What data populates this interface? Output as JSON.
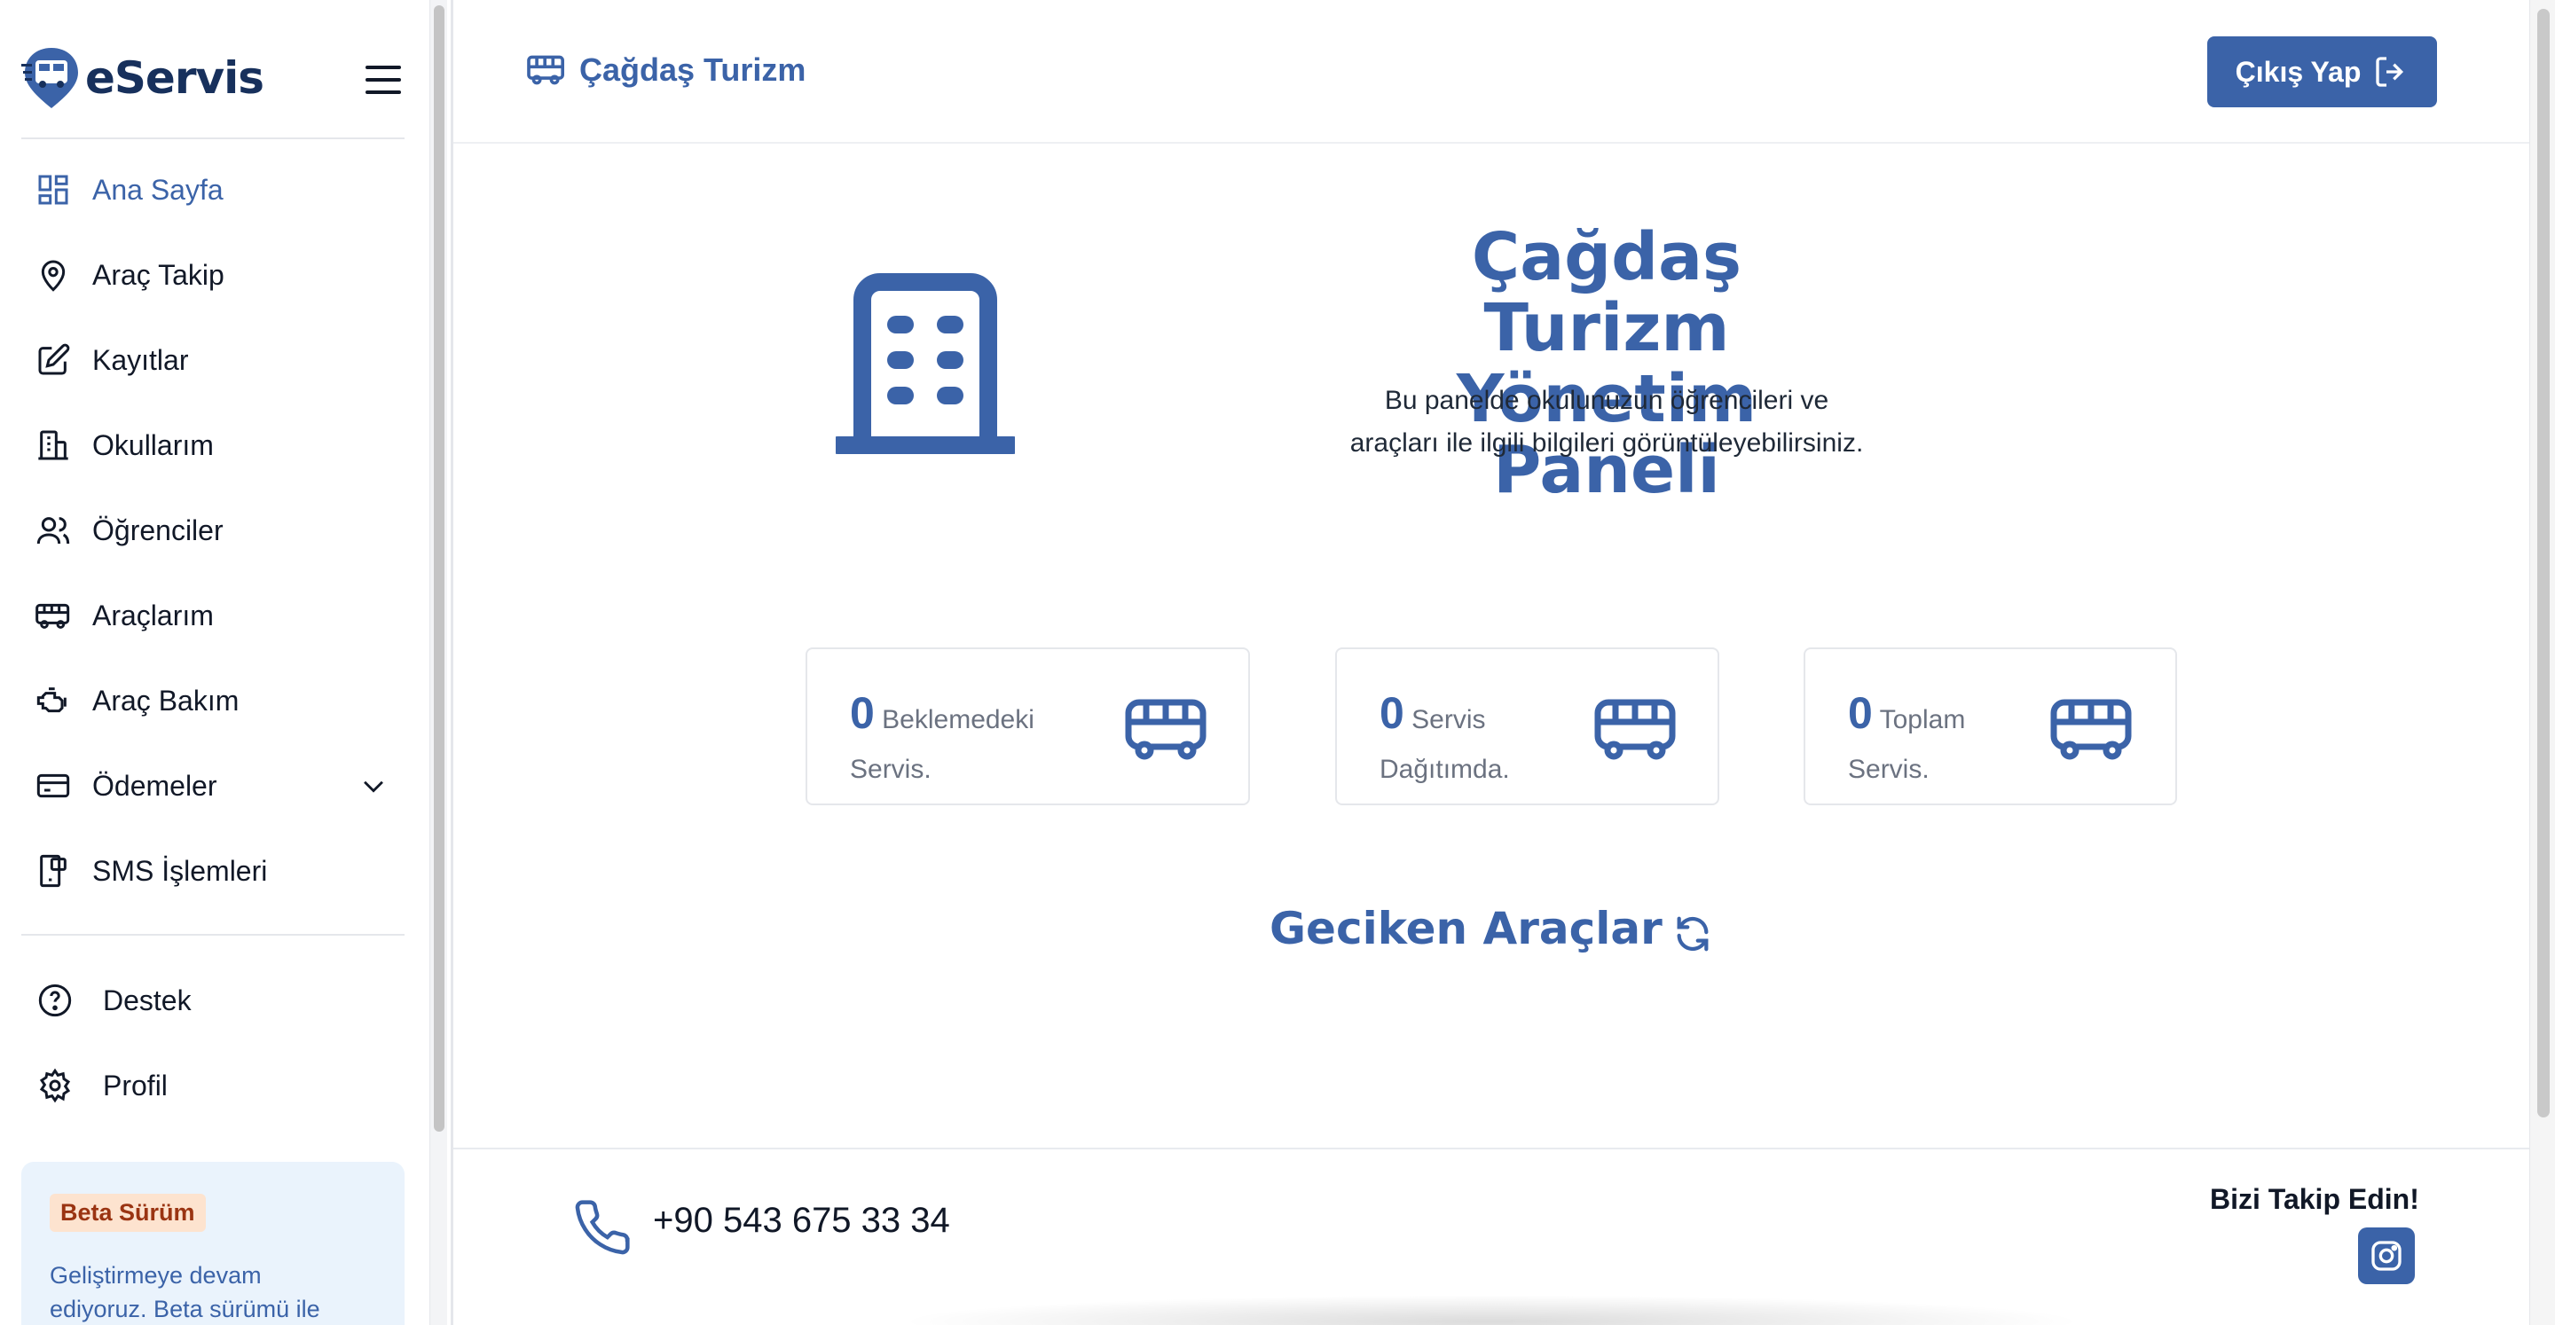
{
  "sidebar": {
    "brand": "eServis",
    "nav": [
      {
        "label": "Ana Sayfa",
        "icon": "dashboard-icon",
        "active": true
      },
      {
        "label": "Araç Takip",
        "icon": "map-pin-icon"
      },
      {
        "label": "Kayıtlar",
        "icon": "edit-icon"
      },
      {
        "label": "Okullarım",
        "icon": "building-icon"
      },
      {
        "label": "Öğrenciler",
        "icon": "users-icon"
      },
      {
        "label": "Araçlarım",
        "icon": "bus-icon"
      },
      {
        "label": "Araç Bakım",
        "icon": "engine-icon"
      },
      {
        "label": "Ödemeler",
        "icon": "credit-card-icon",
        "expandable": true
      },
      {
        "label": "SMS İşlemleri",
        "icon": "sms-icon"
      }
    ],
    "nav2": [
      {
        "label": "Destek",
        "icon": "help-icon"
      },
      {
        "label": "Profil",
        "icon": "gear-icon"
      }
    ],
    "beta": {
      "badge": "Beta Sürüm",
      "text": "Geliştirmeye devam ediyoruz. Beta sürümü ile"
    }
  },
  "header": {
    "company": "Çağdaş Turizm",
    "logout": "Çıkış Yap"
  },
  "hero": {
    "title": "Çağdaş Turizm Yönetim Paneli",
    "subtitle": "Bu panelde okulunuzun öğrencileri ve araçları ile ilgili bilgileri görüntüleyebilirsiniz."
  },
  "stats": [
    {
      "value": "0",
      "label": "Beklemedeki Servis."
    },
    {
      "value": "0",
      "label": "Servis Dağıtımda."
    },
    {
      "value": "0",
      "label": "Toplam Servis."
    }
  ],
  "late": {
    "title": "Geciken Araçlar"
  },
  "footer": {
    "phone": "+90 543 675 33 34",
    "follow": "Bizi Takip Edin!"
  },
  "colors": {
    "accent": "#3b63a8",
    "brand_dark": "#17305c",
    "beta_bg": "#eaf3fc",
    "badge_bg": "#fde3cf"
  }
}
